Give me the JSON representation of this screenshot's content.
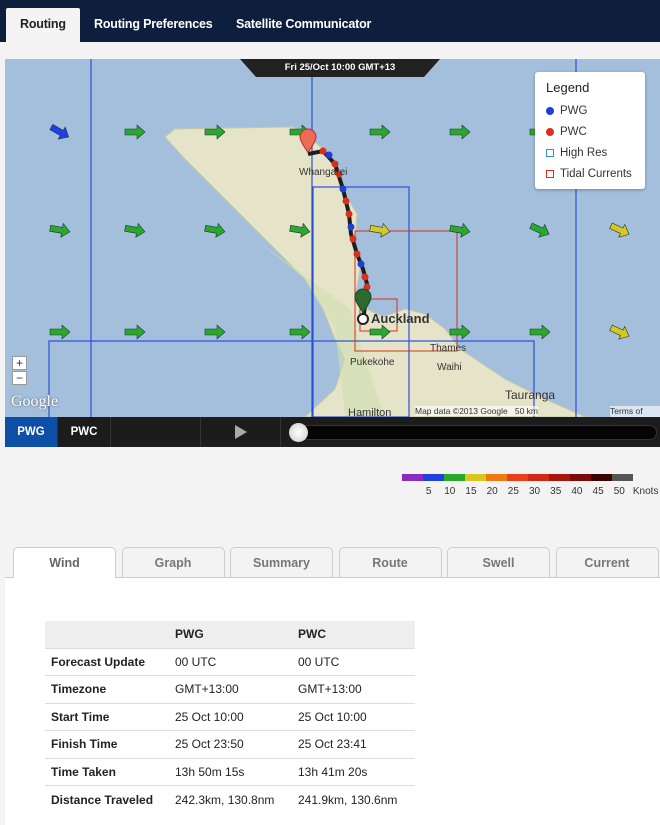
{
  "nav": {
    "tabs": [
      {
        "label": "Routing",
        "active": true
      },
      {
        "label": "Routing Preferences"
      },
      {
        "label": "Satellite Communicator"
      }
    ]
  },
  "map": {
    "time_label": "Fri 25/Oct 10:00 GMT+13",
    "legend": {
      "title": "Legend",
      "items": [
        {
          "label": "PWG",
          "color": "#1f3fd6"
        },
        {
          "label": "PWC",
          "color": "#d8301c"
        },
        {
          "label": "High Res",
          "color": "#3b8fd6"
        },
        {
          "label": "Tidal Currents",
          "color": "#d8301c"
        }
      ]
    },
    "places": [
      "Whangarei",
      "Auckland",
      "Thames",
      "Pukekohe",
      "Waihi",
      "Tauranga",
      "Hamilton"
    ],
    "zoom_in": "+",
    "zoom_out": "−",
    "logo": "Google",
    "attribution": "Map data ©2013 Google",
    "scale_label": "50 km",
    "terms": "Terms of Use"
  },
  "controls": {
    "routes": [
      {
        "label": "PWG",
        "active": true
      },
      {
        "label": "PWC"
      }
    ],
    "play_icon": "play-icon",
    "progress": 0
  },
  "wind_scale": {
    "colors": [
      "#8a2cc0",
      "#1f3fe0",
      "#2aa82a",
      "#d6c81e",
      "#ee7a12",
      "#e8401a",
      "#d02a16",
      "#a8160e",
      "#7a0c08",
      "#3a0604",
      "#555555"
    ],
    "ticks": [
      "5",
      "10",
      "15",
      "20",
      "25",
      "30",
      "35",
      "40",
      "45",
      "50"
    ],
    "unit": "Knots"
  },
  "bottom_tabs": [
    {
      "label": "Wind",
      "active": true
    },
    {
      "label": "Graph"
    },
    {
      "label": "Summary"
    },
    {
      "label": "Route"
    },
    {
      "label": "Swell"
    },
    {
      "label": "Current"
    }
  ],
  "table": {
    "columns": [
      "",
      "PWG",
      "PWC"
    ],
    "rows": [
      [
        "Forecast Update",
        "00 UTC",
        "00 UTC"
      ],
      [
        "Timezone",
        "GMT+13:00",
        "GMT+13:00"
      ],
      [
        "Start Time",
        "25 Oct 10:00",
        "25 Oct 10:00"
      ],
      [
        "Finish Time",
        "25 Oct 23:50",
        "25 Oct 23:41"
      ],
      [
        "Time Taken",
        "13h 50m 15s",
        "13h 41m 20s"
      ],
      [
        "Distance Traveled",
        "242.3km, 130.8nm",
        "241.9km, 130.6nm"
      ]
    ]
  }
}
